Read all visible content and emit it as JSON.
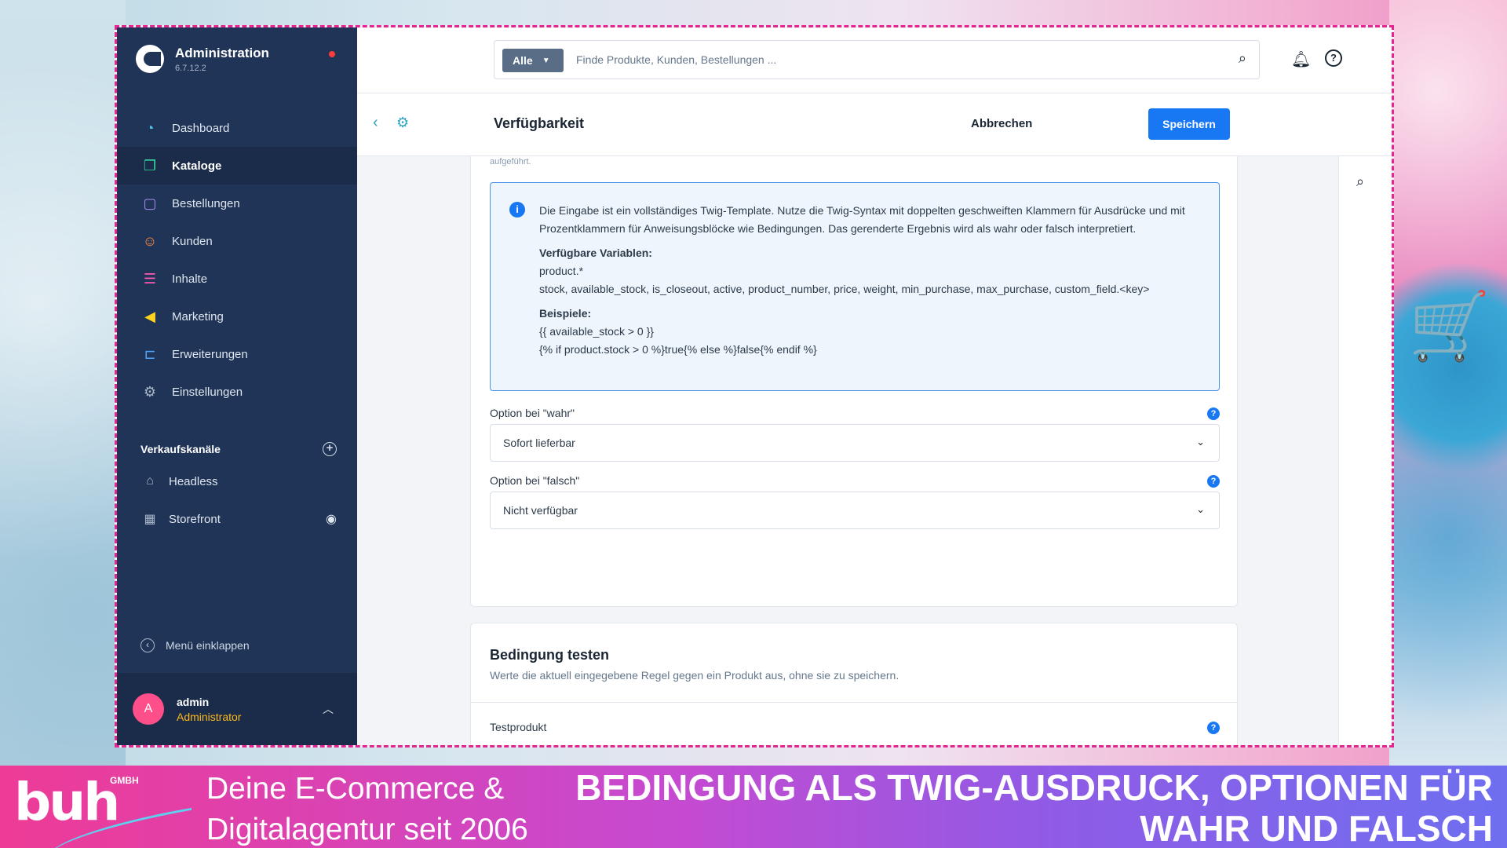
{
  "sidebar": {
    "brand_title": "Administration",
    "brand_version": "6.7.12.2",
    "nav": [
      {
        "label": "Dashboard",
        "icon": "dashboard-icon"
      },
      {
        "label": "Kataloge",
        "icon": "catalog-icon"
      },
      {
        "label": "Bestellungen",
        "icon": "orders-icon"
      },
      {
        "label": "Kunden",
        "icon": "customers-icon"
      },
      {
        "label": "Inhalte",
        "icon": "content-icon"
      },
      {
        "label": "Marketing",
        "icon": "marketing-icon"
      },
      {
        "label": "Erweiterungen",
        "icon": "extensions-icon"
      },
      {
        "label": "Einstellungen",
        "icon": "settings-icon"
      }
    ],
    "active_item": "Kataloge",
    "sales_channels_title": "Verkaufskanäle",
    "sales_channels": [
      "Headless",
      "Storefront"
    ],
    "collapse_label": "Menü einklappen",
    "user": {
      "initial": "A",
      "name": "admin",
      "role": "Administrator"
    }
  },
  "topbar": {
    "search_scope": "Alle",
    "search_placeholder": "Finde Produkte, Kunden, Bestellungen ..."
  },
  "page": {
    "title": "Verfügbarkeit",
    "cancel_label": "Abbrechen",
    "save_label": "Speichern",
    "cut_text": "aufgeführt."
  },
  "info": {
    "text": "Die Eingabe ist ein vollständiges Twig-Template. Nutze die Twig-Syntax mit doppelten geschweiften Klammern für Ausdrücke und mit Prozentklammern für Anweisungsblöcke wie Bedingungen. Das gerenderte Ergebnis wird als wahr oder falsch interpretiert.",
    "vars_title": "Verfügbare Variablen:",
    "vars_line1": "product.*",
    "vars_line2": "stock, available_stock, is_closeout, active, product_number, price, weight, min_purchase, max_purchase, custom_field.<key>",
    "examples_title": "Beispiele:",
    "example1": "{{ available_stock > 0 }}",
    "example2": "{% if product.stock > 0 %}true{% else %}false{% endif %}"
  },
  "fields": {
    "true_label": "Option bei \"wahr\"",
    "true_value": "Sofort lieferbar",
    "false_label": "Option bei \"falsch\"",
    "false_value": "Nicht verfügbar"
  },
  "test": {
    "title": "Bedingung testen",
    "subtitle": "Werte die aktuell eingegebene Regel gegen ein Produkt aus, ohne sie zu speichern.",
    "product_label": "Testprodukt"
  },
  "banner": {
    "logo_text": "buh",
    "logo_suffix": "GMBH",
    "tagline_line1": "Deine E-Commerce &",
    "tagline_line2": "Digitalagentur seit 2006",
    "headline_line1": "BEDINGUNG ALS TWIG-AUSDRUCK, OPTIONEN FÜR",
    "headline_line2": "WAHR UND FALSCH"
  },
  "colors": {
    "sidebar": "#1f3456",
    "primary": "#1877f2",
    "accent_pink": "#e5258f",
    "user_role": "#ffb81c"
  }
}
